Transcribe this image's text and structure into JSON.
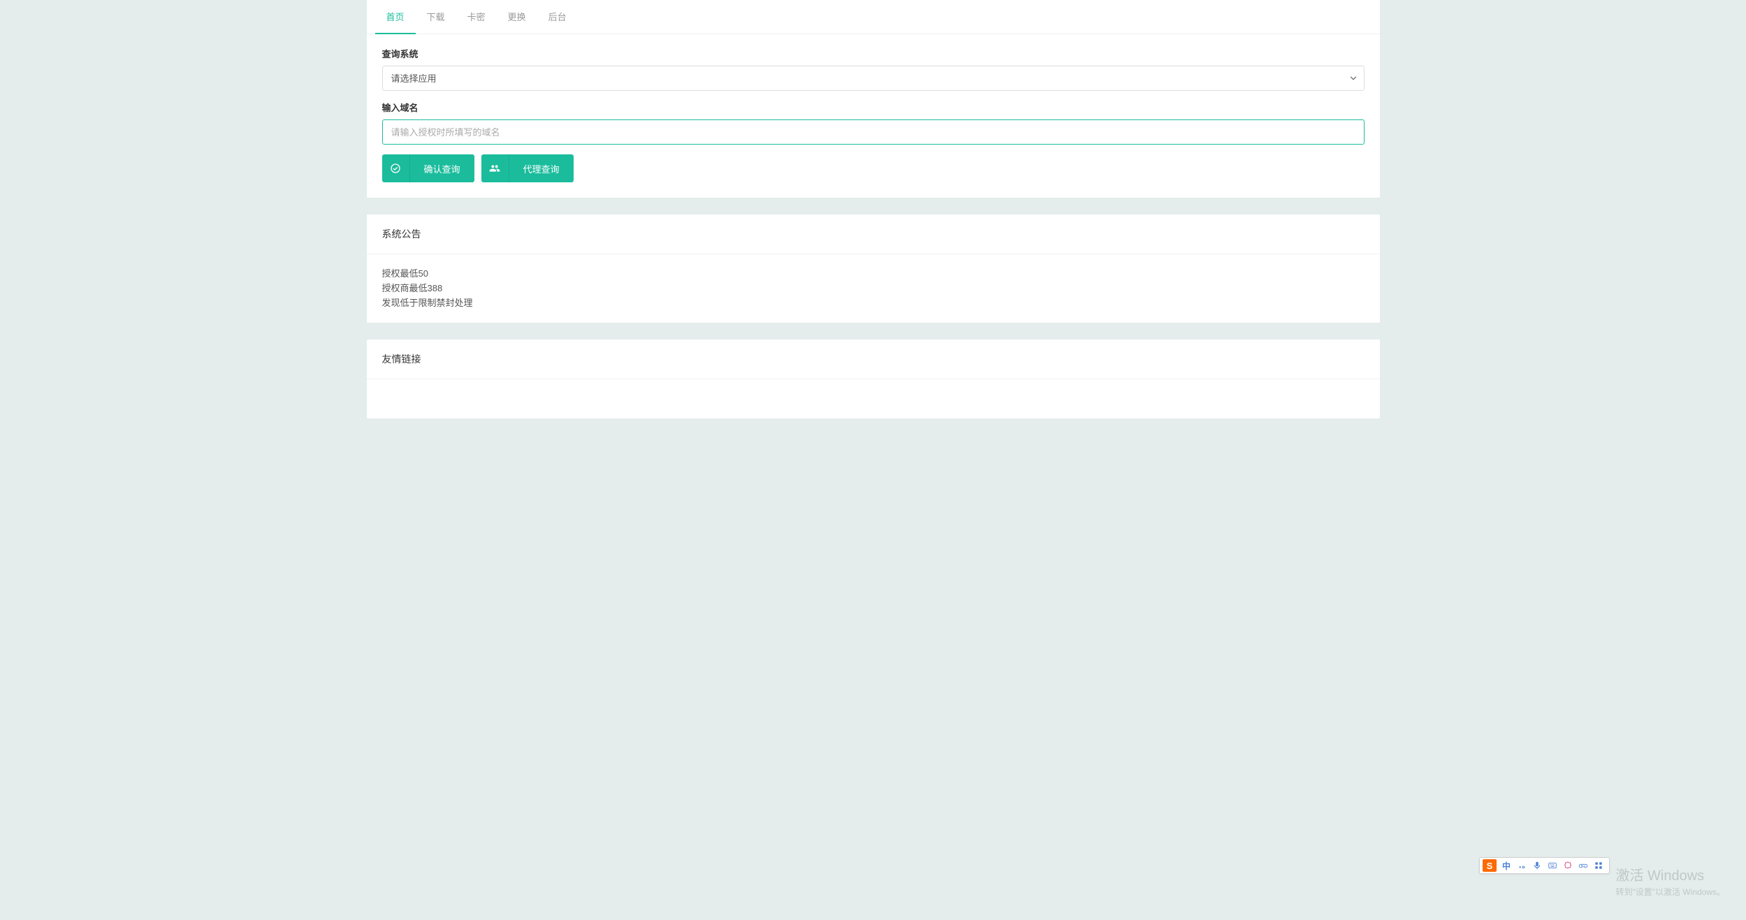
{
  "tabs": {
    "home": "首页",
    "download": "下载",
    "card": "卡密",
    "replace": "更换",
    "admin": "后台"
  },
  "form": {
    "system_label": "查询系统",
    "system_placeholder": "请选择应用",
    "domain_label": "输入域名",
    "domain_placeholder": "请输入授权时所填写的域名",
    "domain_value": ""
  },
  "buttons": {
    "confirm": "确认查询",
    "agent": "代理查询"
  },
  "notice": {
    "title": "系统公告",
    "line1": "授权最低50",
    "line2": "授权商最低388",
    "line3": "发现低于限制禁封处理"
  },
  "links": {
    "title": "友情链接"
  },
  "watermark": {
    "title": "激活 Windows",
    "subtitle": "转到\"设置\"以激活 Windows。"
  },
  "ime": {
    "logo": "S",
    "lang": "中"
  }
}
